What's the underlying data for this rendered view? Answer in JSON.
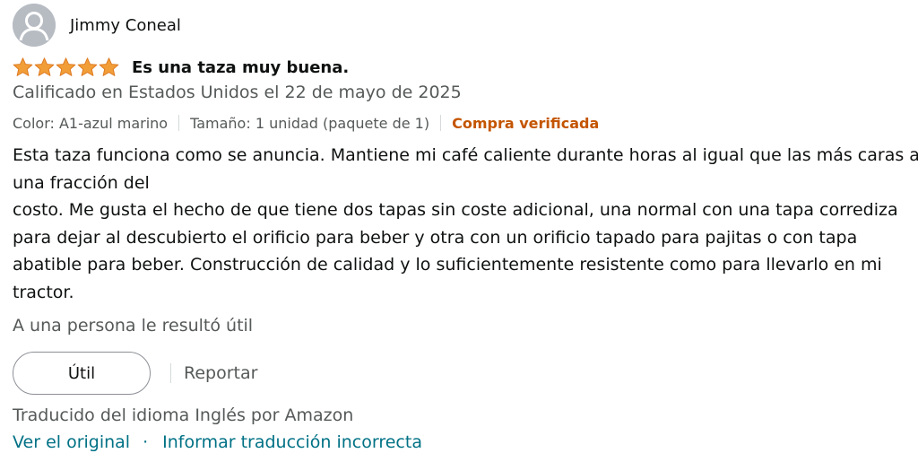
{
  "reviewer": {
    "name": "Jimmy Coneal",
    "avatar_icon": "default-user-avatar-icon"
  },
  "rating": {
    "stars": 5,
    "max": 5,
    "color": "#f19e38"
  },
  "review": {
    "title": "Es una taza muy buena.",
    "date_text": "Calificado en Estados Unidos el 22 de mayo de 2025",
    "color": "Color: A1-azul marino",
    "size": "Tamaño: 1 unidad (paquete de 1)",
    "verified": "Compra verificada",
    "body_lines": [
      "Esta taza funciona como se anuncia. Mantiene mi café caliente durante horas al igual que las más caras a",
      "una fracción del",
      "costo. Me gusta el hecho de que tiene dos tapas sin coste adicional, una normal con una tapa corrediza",
      "para dejar al descubierto el orificio para beber y otra con un orificio tapado para pajitas o con tapa",
      "abatible para beber. Construcción de calidad y lo suficientemente resistente como para llevarlo en mi",
      "tractor."
    ]
  },
  "helpful": {
    "count_text": "A una persona le resultó útil",
    "button_label": "Útil",
    "report_label": "Reportar"
  },
  "translation": {
    "note": "Traducido del idioma Inglés por Amazon",
    "view_original": "Ver el original",
    "separator": "·",
    "report_translation": "Informar traducción incorrecta"
  },
  "colors": {
    "verified": "#c45500",
    "link": "#007185",
    "secondary_text": "#565959"
  }
}
